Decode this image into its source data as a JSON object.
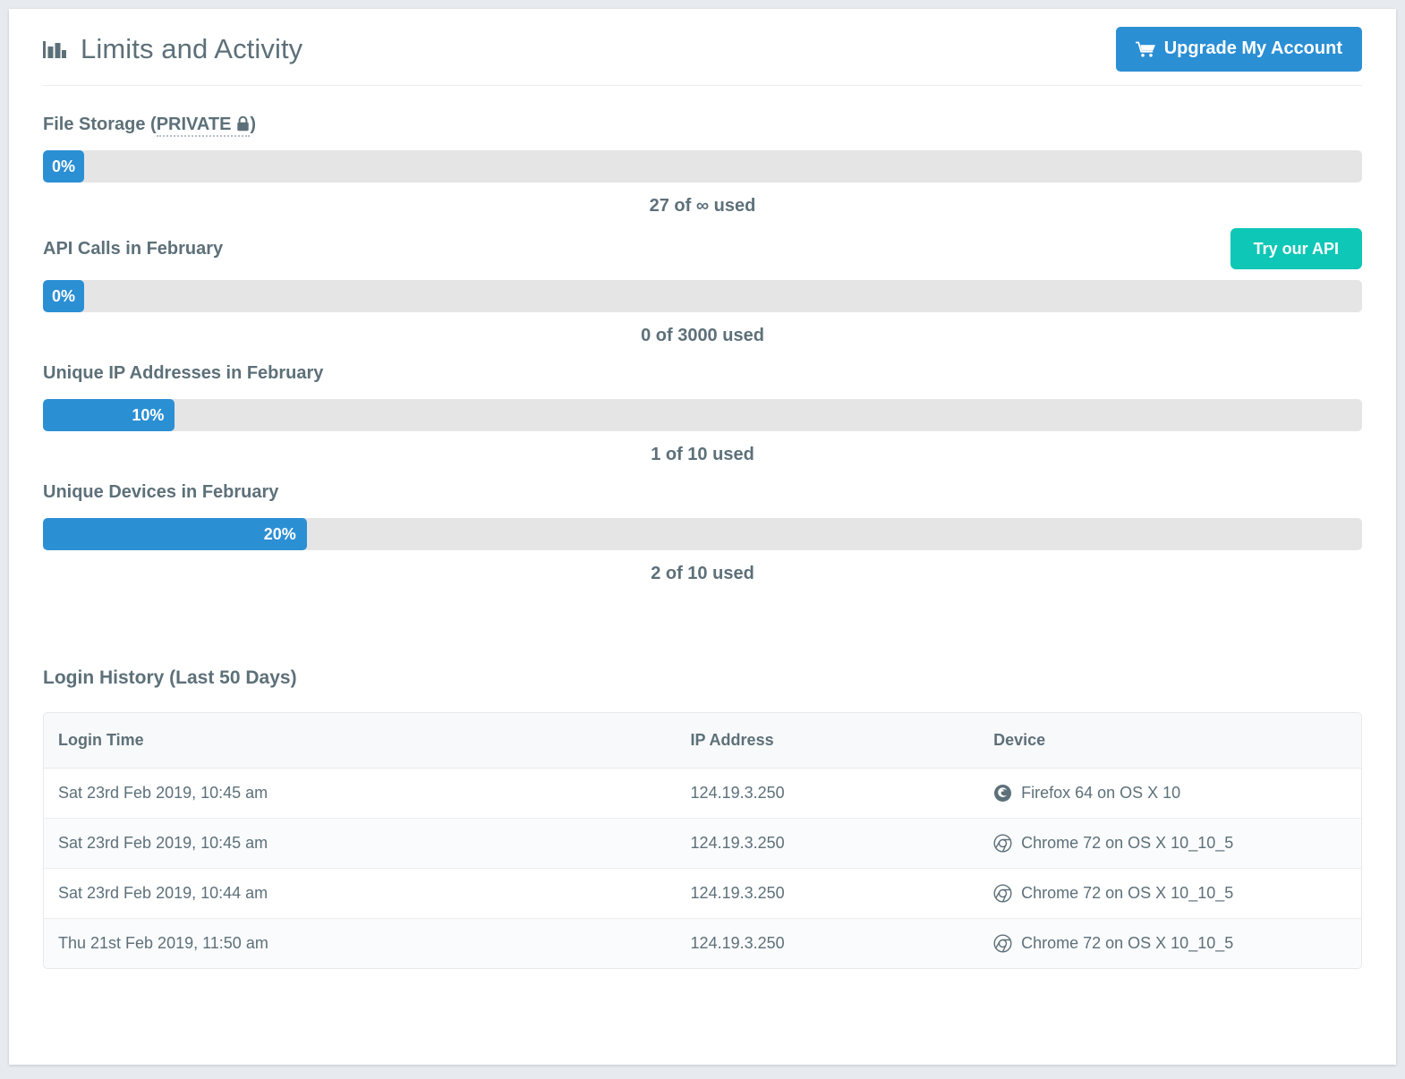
{
  "header": {
    "icon": "bar-chart-icon",
    "title": "Limits and Activity",
    "upgrade_button": {
      "label": "Upgrade My Account",
      "icon": "shopping-cart-icon",
      "color": "#2b8fd4"
    }
  },
  "meters": [
    {
      "label_prefix": "File Storage (",
      "label_tag": "PRIVATE",
      "label_suffix": ")",
      "tag_icon": "lock-icon",
      "percent_text": "0%",
      "percent_value": 0,
      "used_text": "27 of ∞ used",
      "action": null
    },
    {
      "label_prefix": "API Calls in February",
      "label_tag": "",
      "label_suffix": "",
      "tag_icon": "",
      "percent_text": "0%",
      "percent_value": 0,
      "used_text": "0 of 3000 used",
      "action": {
        "label": "Try our API",
        "color": "#0ec7b6"
      }
    },
    {
      "label_prefix": "Unique IP Addresses in February",
      "label_tag": "",
      "label_suffix": "",
      "tag_icon": "",
      "percent_text": "10%",
      "percent_value": 10,
      "used_text": "1 of 10 used",
      "action": null
    },
    {
      "label_prefix": "Unique Devices in February",
      "label_tag": "",
      "label_suffix": "",
      "tag_icon": "",
      "percent_text": "20%",
      "percent_value": 20,
      "used_text": "2 of 10 used",
      "action": null
    }
  ],
  "history": {
    "title": "Login History (Last 50 Days)",
    "columns": [
      "Login Time",
      "IP Address",
      "Device"
    ],
    "rows": [
      {
        "time": "Sat 23rd Feb 2019, 10:45 am",
        "ip": "124.19.3.250",
        "device": "Firefox 64 on OS X 10",
        "browser": "firefox-icon"
      },
      {
        "time": "Sat 23rd Feb 2019, 10:45 am",
        "ip": "124.19.3.250",
        "device": "Chrome 72 on OS X 10_10_5",
        "browser": "chrome-icon"
      },
      {
        "time": "Sat 23rd Feb 2019, 10:44 am",
        "ip": "124.19.3.250",
        "device": "Chrome 72 on OS X 10_10_5",
        "browser": "chrome-icon"
      },
      {
        "time": "Thu 21st Feb 2019, 11:50 am",
        "ip": "124.19.3.250",
        "device": "Chrome 72 on OS X 10_10_5",
        "browser": "chrome-icon"
      }
    ]
  },
  "colors": {
    "accent_blue": "#2b8fd4",
    "accent_teal": "#0ec7b6",
    "track_gray": "#e5e5e5",
    "text_slate": "#5d7079"
  }
}
